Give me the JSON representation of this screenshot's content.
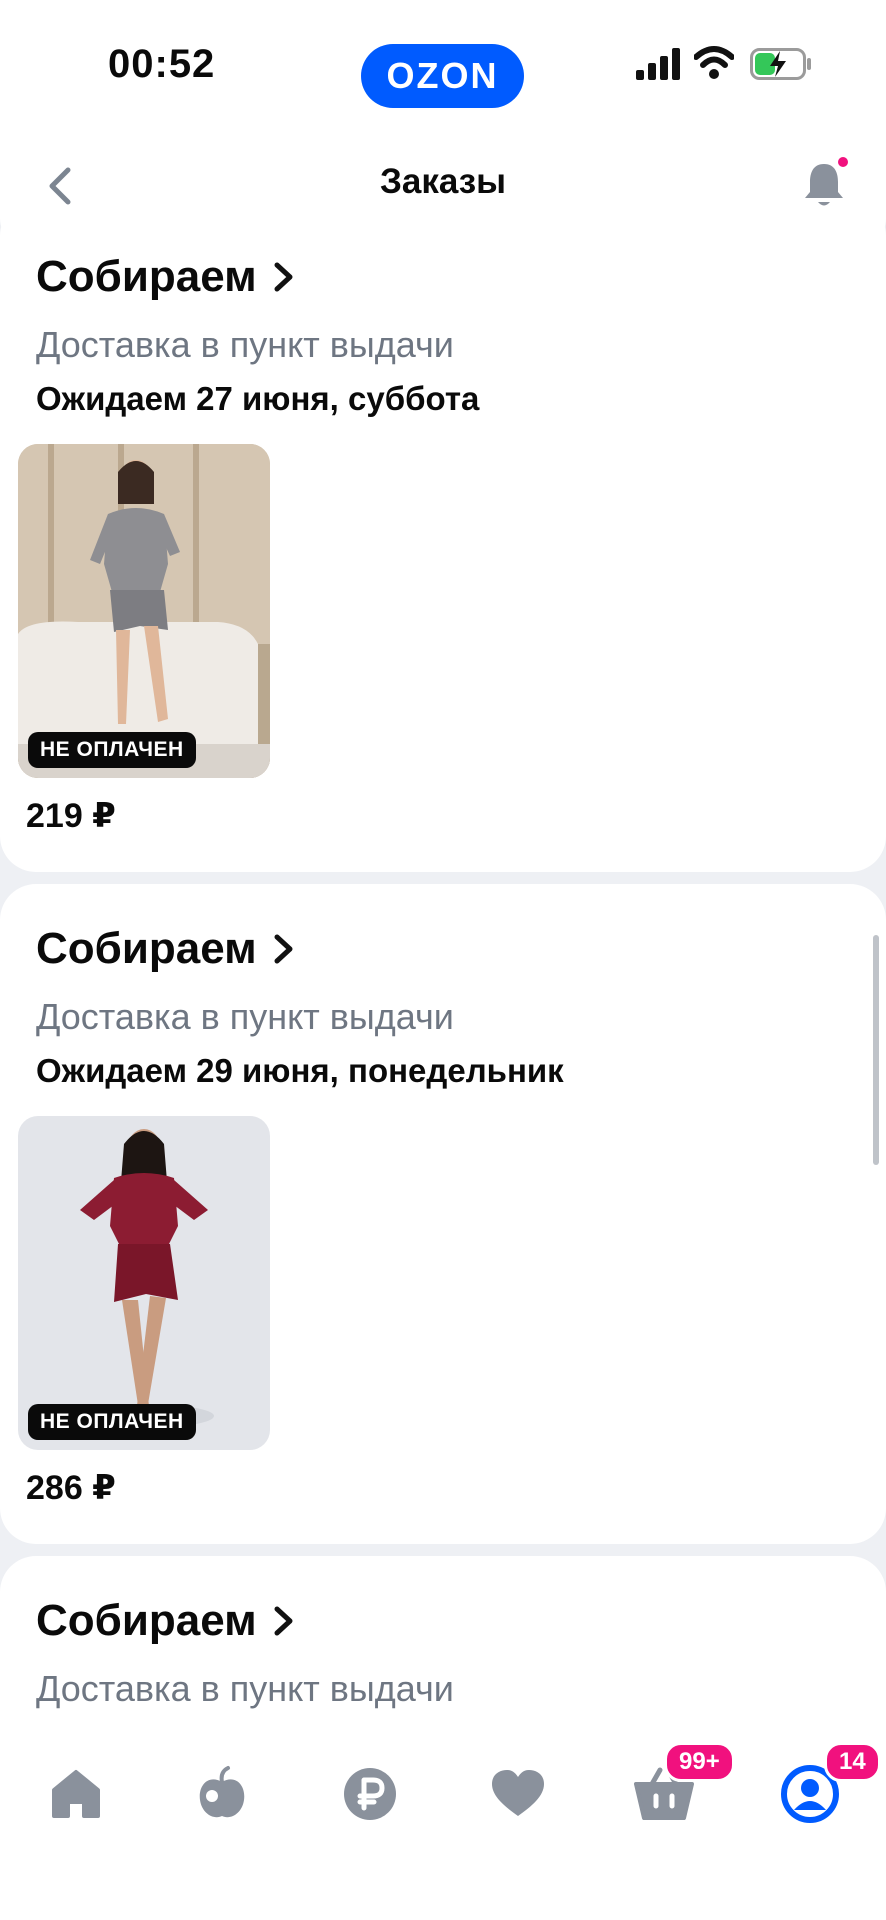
{
  "status_bar": {
    "time": "00:52",
    "brand": "OZON"
  },
  "header": {
    "title": "Заказы"
  },
  "orders": [
    {
      "status": "Собираем",
      "delivery": "Доставка в пункт выдачи",
      "expected": "Ожидаем 27 июня, суббота",
      "badge": "НЕ ОПЛАЧЕН",
      "price": "219 ₽"
    },
    {
      "status": "Собираем",
      "delivery": "Доставка в пункт выдачи",
      "expected": "Ожидаем 29 июня, понедельник",
      "badge": "НЕ ОПЛАЧЕН",
      "price": "286 ₽"
    },
    {
      "status": "Собираем",
      "delivery": "Доставка в пункт выдачи"
    }
  ],
  "tabbar": {
    "cart_count": "99+",
    "profile_count": "14",
    "accent": "#005bff",
    "badge_color": "#f1117e"
  },
  "icons": [
    "back-icon",
    "bell-icon",
    "home-icon",
    "fresh-icon",
    "ruble-icon",
    "heart-icon",
    "cart-icon",
    "profile-icon"
  ]
}
